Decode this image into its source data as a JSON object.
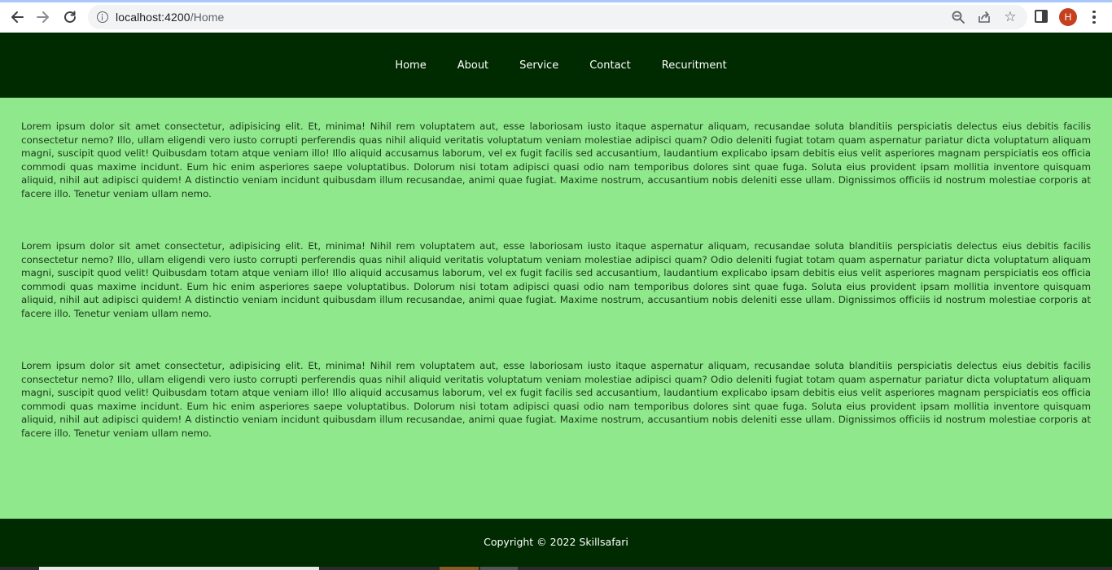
{
  "browser": {
    "url_host": "localhost:4200",
    "url_path": "/Home",
    "avatar_letter": "H",
    "icons": [
      "back-arrow-icon",
      "forward-arrow-icon",
      "reload-icon",
      "info-icon",
      "zoom-icon",
      "share-icon",
      "star-icon",
      "side-panel-icon",
      "kebab-menu-icon"
    ]
  },
  "nav": {
    "items": [
      {
        "label": "Home"
      },
      {
        "label": "About"
      },
      {
        "label": "Service"
      },
      {
        "label": "Contact"
      },
      {
        "label": "Recuritment"
      }
    ]
  },
  "content": {
    "paragraphs": [
      "Lorem ipsum dolor sit amet consectetur, adipisicing elit. Et, minima! Nihil rem voluptatem aut, esse laboriosam iusto itaque aspernatur aliquam, recusandae soluta blanditiis perspiciatis delectus eius debitis facilis consectetur nemo? Illo, ullam eligendi vero iusto corrupti perferendis quas nihil aliquid veritatis voluptatum veniam molestiae adipisci quam? Odio deleniti fugiat totam quam aspernatur pariatur dicta voluptatum aliquam magni, suscipit quod velit! Quibusdam totam atque veniam illo! Illo aliquid accusamus laborum, vel ex fugit facilis sed accusantium, laudantium explicabo ipsam debitis eius velit asperiores magnam perspiciatis eos officia commodi quas maxime incidunt. Eum hic enim asperiores saepe voluptatibus. Dolorum nisi totam adipisci quasi odio nam temporibus dolores sint quae fuga. Soluta eius provident ipsam mollitia inventore quisquam aliquid, nihil aut adipisci quidem! A distinctio veniam incidunt quibusdam illum recusandae, animi quae fugiat. Maxime nostrum, accusantium nobis deleniti esse ullam. Dignissimos officiis id nostrum molestiae corporis at facere illo. Tenetur veniam ullam nemo.",
      "Lorem ipsum dolor sit amet consectetur, adipisicing elit. Et, minima! Nihil rem voluptatem aut, esse laboriosam iusto itaque aspernatur aliquam, recusandae soluta blanditiis perspiciatis delectus eius debitis facilis consectetur nemo? Illo, ullam eligendi vero iusto corrupti perferendis quas nihil aliquid veritatis voluptatum veniam molestiae adipisci quam? Odio deleniti fugiat totam quam aspernatur pariatur dicta voluptatum aliquam magni, suscipit quod velit! Quibusdam totam atque veniam illo! Illo aliquid accusamus laborum, vel ex fugit facilis sed accusantium, laudantium explicabo ipsam debitis eius velit asperiores magnam perspiciatis eos officia commodi quas maxime incidunt. Eum hic enim asperiores saepe voluptatibus. Dolorum nisi totam adipisci quasi odio nam temporibus dolores sint quae fuga. Soluta eius provident ipsam mollitia inventore quisquam aliquid, nihil aut adipisci quidem! A distinctio veniam incidunt quibusdam illum recusandae, animi quae fugiat. Maxime nostrum, accusantium nobis deleniti esse ullam. Dignissimos officiis id nostrum molestiae corporis at facere illo. Tenetur veniam ullam nemo.",
      "Lorem ipsum dolor sit amet consectetur, adipisicing elit. Et, minima! Nihil rem voluptatem aut, esse laboriosam iusto itaque aspernatur aliquam, recusandae soluta blanditiis perspiciatis delectus eius debitis facilis consectetur nemo? Illo, ullam eligendi vero iusto corrupti perferendis quas nihil aliquid veritatis voluptatum veniam molestiae adipisci quam? Odio deleniti fugiat totam quam aspernatur pariatur dicta voluptatum aliquam magni, suscipit quod velit! Quibusdam totam atque veniam illo! Illo aliquid accusamus laborum, vel ex fugit facilis sed accusantium, laudantium explicabo ipsam debitis eius velit asperiores magnam perspiciatis eos officia commodi quas maxime incidunt. Eum hic enim asperiores saepe voluptatibus. Dolorum nisi totam adipisci quasi odio nam temporibus dolores sint quae fuga. Soluta eius provident ipsam mollitia inventore quisquam aliquid, nihil aut adipisci quidem! A distinctio veniam incidunt quibusdam illum recusandae, animi quae fugiat. Maxime nostrum, accusantium nobis deleniti esse ullam. Dignissimos officiis id nostrum molestiae corporis at facere illo. Tenetur veniam ullam nemo."
    ]
  },
  "footer": {
    "copyright": "Copyright © 2022 Skillsafari"
  },
  "colors": {
    "header_bg": "#002a00",
    "content_bg": "#90e88c",
    "footer_bg": "#002a00",
    "nav_text": "#ffffff"
  }
}
